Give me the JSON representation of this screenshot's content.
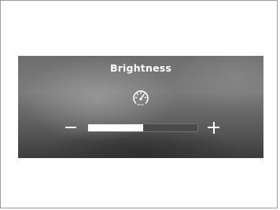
{
  "brightness_panel": {
    "title": "Brightness",
    "icon": "dial-icon",
    "level_fraction": 0.5,
    "decrease_control": "minus",
    "increase_control": "plus"
  }
}
